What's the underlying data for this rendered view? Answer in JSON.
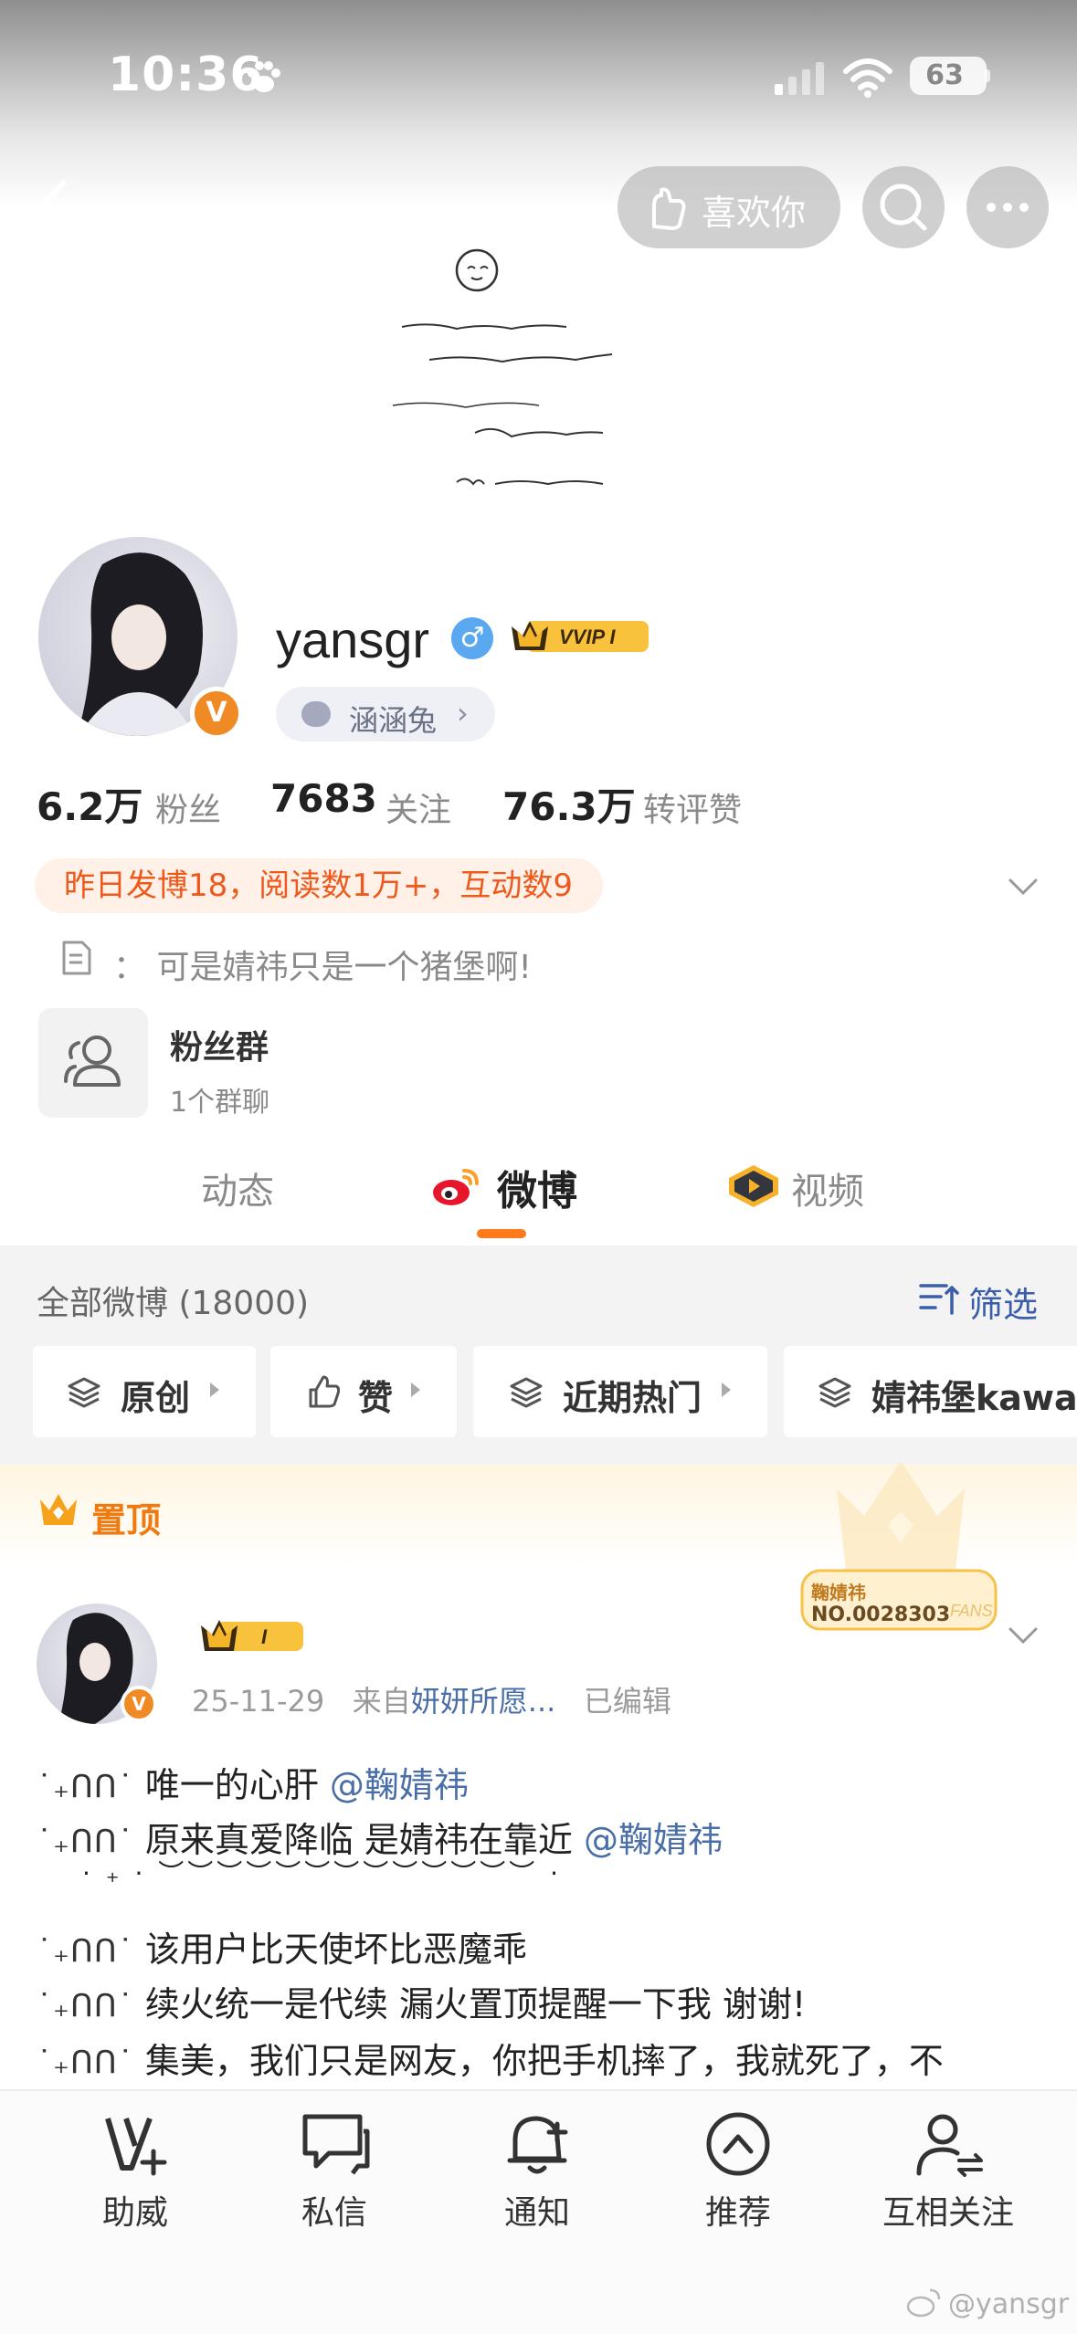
{
  "status_bar": {
    "time": "10:36",
    "battery": "63"
  },
  "header": {
    "like_label": "喜欢你"
  },
  "profile": {
    "username": "yansgr",
    "gender_symbol": "♂",
    "vip_label": "VVIP I",
    "verified_badge": "V",
    "tag_label": "涵涵兔",
    "stats": [
      {
        "value": "6.2万",
        "label": "粉丝"
      },
      {
        "value": "7683",
        "label": "关注"
      },
      {
        "value": "76.3万",
        "label": "转评赞"
      }
    ],
    "summary": "昨日发博18，阅读数1万+，互动数9",
    "description": "：  可是婧祎只是一个猪堡啊!",
    "fan_group": {
      "title": "粉丝群",
      "subtitle": "1个群聊"
    }
  },
  "tabs": [
    {
      "label": "动态",
      "active": false
    },
    {
      "label": "微博",
      "active": true
    },
    {
      "label": "视频",
      "active": false
    }
  ],
  "filter_bar": {
    "all_label": "全部微博 (18000)",
    "filter_label": "筛选",
    "chips": [
      "原创",
      "赞",
      "近期热门",
      "婧祎堡kawai"
    ]
  },
  "pinned": {
    "label": "置顶",
    "fan_card_name": "鞠婧祎",
    "fan_card_no": "NO.0028303",
    "fan_card_brand": "FANS"
  },
  "post": {
    "crown_label": "I",
    "date": "25-11-29",
    "source_prefix": "来自",
    "source": "妍妍所愿...",
    "edited": "已编辑",
    "decoration": "˙₊ᑎᑎ˙",
    "lines": [
      {
        "text": "唯一的心肝 ",
        "mention": "@鞠婧祎"
      },
      {
        "text": "原来真爱降临 是婧祎在靠近 ",
        "mention": "@鞠婧祎"
      },
      {
        "text": "该用户比天使坏比恶魔乖",
        "mention": ""
      },
      {
        "text": "续火统一是代续 漏火置顶提醒一下我 谢谢!",
        "mention": ""
      },
      {
        "text": "集美，我们只是网友，你把手机摔了，我就死了，不",
        "mention": ""
      }
    ],
    "dots_line": "· ₊ ·  ︶︶︶︶︶︶︶︶︶︶︶︶︶   ·"
  },
  "bottom_nav": [
    {
      "label": "助威",
      "icon": "v-plus-icon"
    },
    {
      "label": "私信",
      "icon": "chat-icon"
    },
    {
      "label": "通知",
      "icon": "bell-icon"
    },
    {
      "label": "推荐",
      "icon": "up-arrow-circle-icon"
    },
    {
      "label": "互相关注",
      "icon": "mutual-follow-icon"
    }
  ],
  "watermark": "@yansgr",
  "colors": {
    "accent": "#ff7a1a",
    "link": "#4a6fa8",
    "summary_text": "#ee5a1c"
  }
}
